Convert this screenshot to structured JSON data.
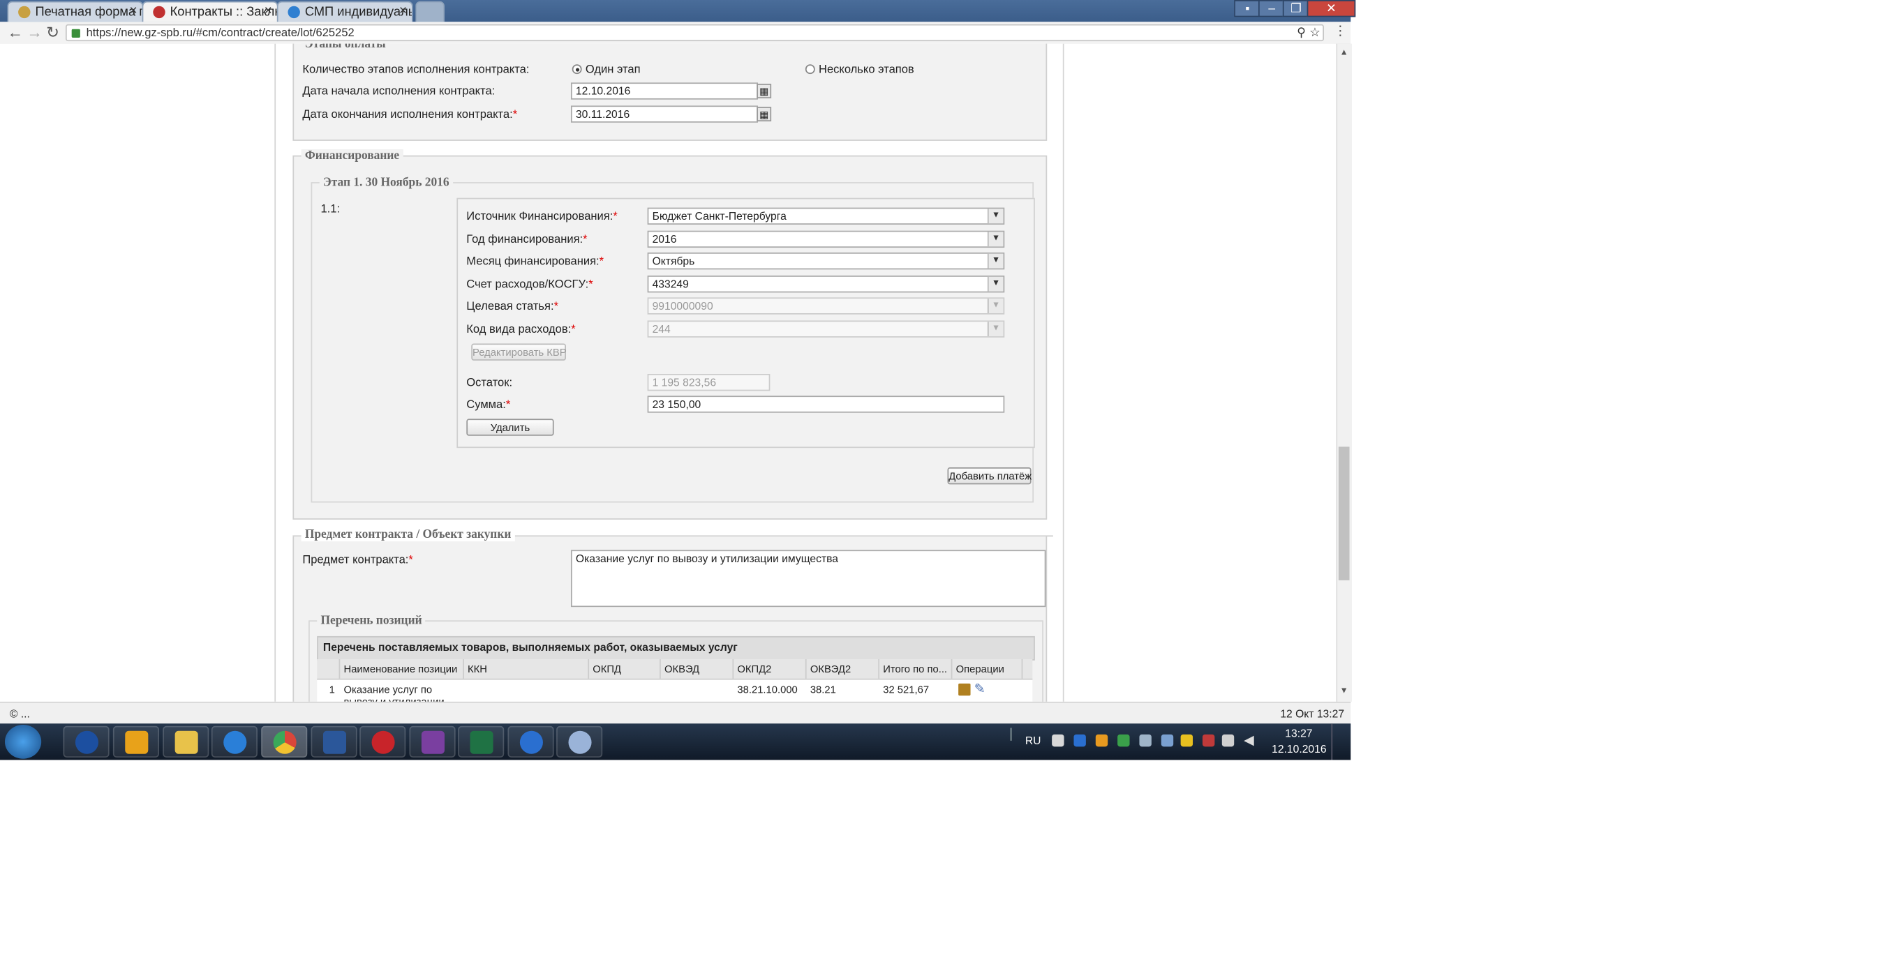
{
  "browser": {
    "tabs": [
      {
        "label": "Печатная форма п",
        "icon": "shield-icon",
        "color": "#c8a040"
      },
      {
        "label": "Контракты :: Заклю",
        "icon": "gz-icon",
        "color": "#c03030"
      },
      {
        "label": "СМП индивидуаль",
        "icon": "globe-icon",
        "color": "#2f7fd1"
      }
    ],
    "url": "https://new.gz-spb.ru/#cm/contract/create/lot/625252"
  },
  "payment_stages": {
    "legend": "Этапы оплаты",
    "count_label": "Количество этапов исполнения контракта:",
    "option_one": "Один этап",
    "option_many": "Несколько этапов",
    "selected": "one",
    "start_label": "Дата начала исполнения контракта:",
    "start_value": "12.10.2016",
    "end_label": "Дата окончания исполнения контракта:",
    "end_value": "30.11.2016"
  },
  "financing": {
    "legend": "Финансирование",
    "stage_legend": "Этап 1. 30 Ноябрь 2016",
    "item_num": "1.1:",
    "source_label": "Источник Финансирования:",
    "source_value": "Бюджет Санкт-Петербурга",
    "year_label": "Год финансирования:",
    "year_value": "2016",
    "month_label": "Месяц финансирования:",
    "month_value": "Октябрь",
    "account_label": "Счет расходов/КОСГУ:",
    "account_value": "433249",
    "target_label": "Целевая статья:",
    "target_value": "9910000090",
    "kvr_label": "Код вида расходов:",
    "kvr_value": "244",
    "edit_kvr_btn": "Редактировать КВР",
    "remainder_label": "Остаток:",
    "remainder_value": "1 195 823,56",
    "sum_label": "Сумма:",
    "sum_value": "23 150,00",
    "delete_btn": "Удалить",
    "add_payment_btn": "Добавить платёж"
  },
  "subject": {
    "legend": "Предмет контракта / Объект закупки",
    "subject_label": "Предмет контракта:",
    "subject_value": "Оказание услуг по вывозу и утилизации имущества",
    "positions_legend": "Перечень позиций",
    "table_title": "Перечень поставляемых товаров, выполняемых работ, оказываемых услуг",
    "columns": [
      "Наименование позиции",
      "ККН",
      "ОКПД",
      "ОКВЭД",
      "ОКПД2",
      "ОКВЭД2",
      "Итого по по...",
      "Операции"
    ],
    "rows": [
      {
        "num": "1",
        "name": "Оказание услуг по",
        "name2": "вывозу и утилизации",
        "kkn": "",
        "okpd": "",
        "okved": "",
        "okpd2": "38.21.10.000",
        "okved2": "38.21",
        "total": "32 521,67"
      }
    ]
  },
  "statusbar": {
    "left": "© ...",
    "right": "12 Окт 13:27"
  },
  "taskbar": {
    "lang": "RU",
    "time": "13:27",
    "date": "12.10.2016",
    "apps": [
      {
        "name": "start-orb-icon",
        "color": "#3a86d6"
      },
      {
        "name": "sphere-app-icon",
        "color": "#1c4fa0"
      },
      {
        "name": "outlook-icon",
        "color": "#e8a21a"
      },
      {
        "name": "explorer-icon",
        "color": "#e8c24a"
      },
      {
        "name": "ie-icon",
        "color": "#2a7fd8"
      },
      {
        "name": "chrome-icon",
        "color": "#d9463a"
      },
      {
        "name": "word-icon",
        "color": "#2b579a"
      },
      {
        "name": "red-app-icon",
        "color": "#c8242a"
      },
      {
        "name": "flag-app-icon",
        "color": "#7a3fa0"
      },
      {
        "name": "excel-icon",
        "color": "#1f7244"
      },
      {
        "name": "e-app-icon",
        "color": "#2a6fd0"
      },
      {
        "name": "paint-icon",
        "color": "#9ab3d8"
      }
    ]
  }
}
